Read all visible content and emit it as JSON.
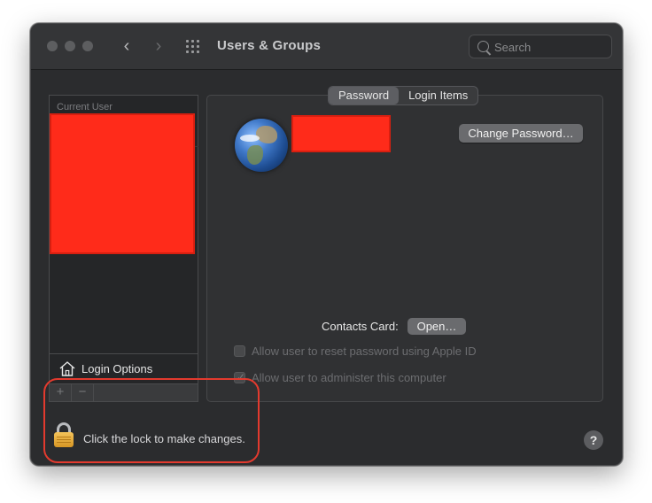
{
  "window": {
    "title": "Users & Groups",
    "back_icon": "‹",
    "forward_icon": "›",
    "grid_icon": "grid-icon"
  },
  "search": {
    "placeholder": "Search",
    "value": ""
  },
  "sidebar": {
    "header": "Current User",
    "login_options": "Login Options",
    "add_label": "+",
    "remove_label": "−"
  },
  "tabs": [
    {
      "label": "Password",
      "active": true
    },
    {
      "label": "Login Items",
      "active": false
    }
  ],
  "account": {
    "change_password": "Change Password…",
    "contacts_card_label": "Contacts Card:",
    "open_button": "Open…",
    "allow_reset": "Allow user to reset password using Apple ID",
    "allow_reset_checked": false,
    "allow_admin": "Allow user to administer this computer",
    "allow_admin_checked": true
  },
  "footer": {
    "lock_text": "Click the lock to make changes.",
    "help_label": "?"
  },
  "colors": {
    "redaction": "#ff2b1a",
    "annotation": "#e33a2e",
    "window_bg": "#2b2c2e"
  }
}
